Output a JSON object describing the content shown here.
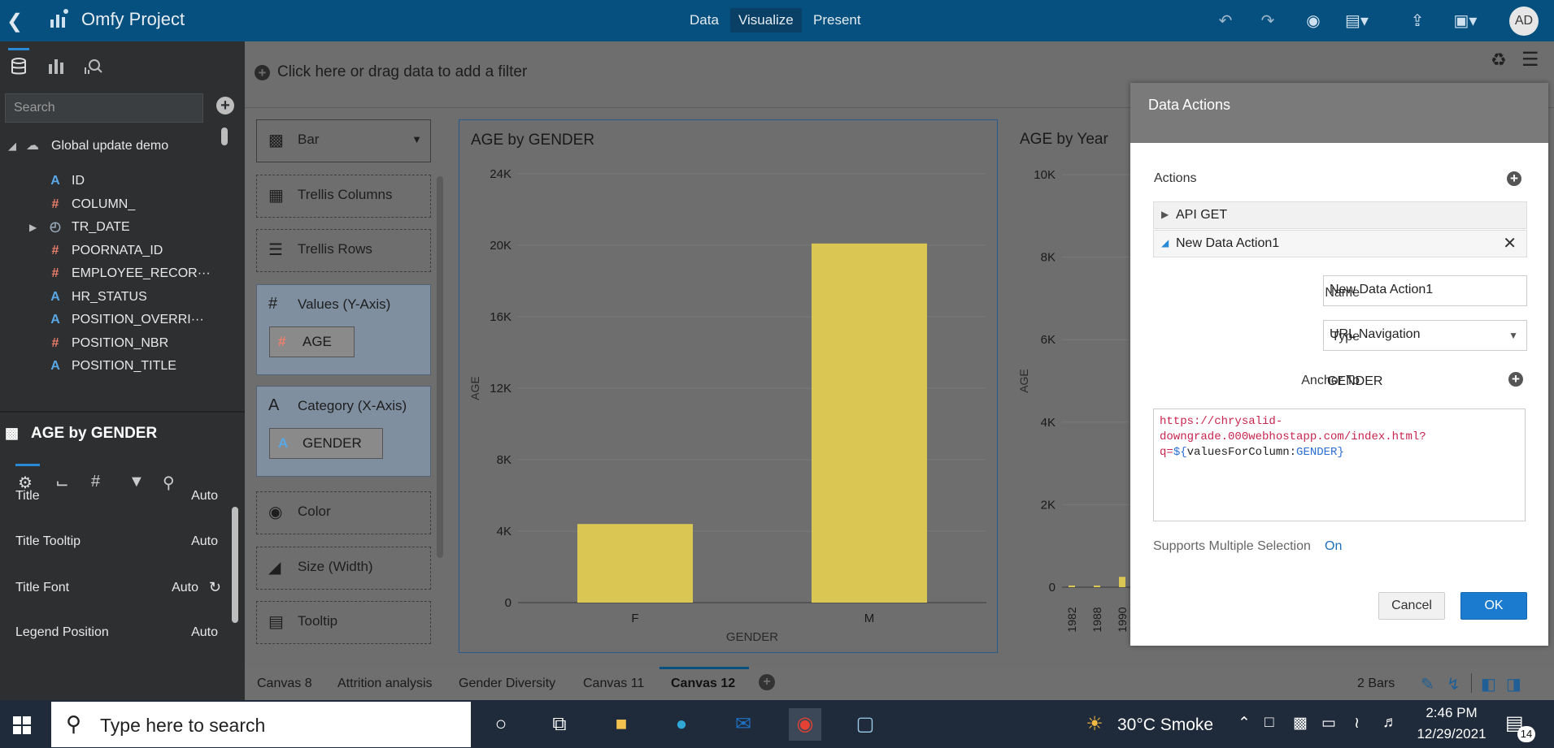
{
  "app": {
    "title": "Omfy Project",
    "modes": [
      "Data",
      "Visualize",
      "Present"
    ],
    "active_mode": "Visualize",
    "avatar": "AD"
  },
  "left_panel": {
    "search_placeholder": "Search",
    "dataset": "Global update demo",
    "columns": [
      {
        "name": "ID",
        "type": "A"
      },
      {
        "name": "COLUMN_",
        "type": "#"
      },
      {
        "name": "TR_DATE",
        "type": "date"
      },
      {
        "name": "POORNATA_ID",
        "type": "#"
      },
      {
        "name": "EMPLOYEE_RECOR···",
        "type": "#"
      },
      {
        "name": "HR_STATUS",
        "type": "A"
      },
      {
        "name": "POSITION_OVERRI···",
        "type": "A"
      },
      {
        "name": "POSITION_NBR",
        "type": "#"
      },
      {
        "name": "POSITION_TITLE",
        "type": "A"
      }
    ],
    "viz_title": "AGE by GENDER",
    "properties": [
      {
        "label": "Title",
        "value": "Auto"
      },
      {
        "label": "Title Tooltip",
        "value": "Auto"
      },
      {
        "label": "Title Font",
        "value": "Auto"
      },
      {
        "label": "Legend Position",
        "value": "Auto"
      }
    ]
  },
  "filter_bar": {
    "text": "Click here or drag data to add a filter"
  },
  "grammar": {
    "chart_type": "Bar",
    "trellis_columns": "Trellis Columns",
    "trellis_rows": "Trellis Rows",
    "values_label": "Values (Y-Axis)",
    "values_chip": "AGE",
    "category_label": "Category (X-Axis)",
    "category_chip": "GENDER",
    "color": "Color",
    "size": "Size (Width)",
    "tooltip": "Tooltip"
  },
  "chart_data": [
    {
      "type": "bar",
      "title": "AGE by GENDER",
      "categories": [
        "F",
        "M"
      ],
      "values": [
        4400,
        20100
      ],
      "xlabel": "GENDER",
      "ylabel": "AGE",
      "ylim": [
        0,
        24000
      ],
      "yticks": [
        "0",
        "4K",
        "8K",
        "12K",
        "16K",
        "20K",
        "24K"
      ],
      "color": "#d9c653"
    },
    {
      "type": "bar",
      "title": "AGE by Year",
      "ylabel": "AGE",
      "ylim": [
        0,
        10000
      ],
      "yticks": [
        "0",
        "2K",
        "4K",
        "6K",
        "8K",
        "10K"
      ],
      "categories": [
        "1982",
        "1988",
        "1990"
      ]
    }
  ],
  "canvas_tabs": [
    "Canvas 8",
    "Attrition analysis",
    "Gender Diversity",
    "Canvas 11",
    "Canvas 12"
  ],
  "active_canvas_tab": "Canvas 12",
  "status": {
    "bars": "2 Bars"
  },
  "dialog": {
    "title": "Data Actions",
    "actions_label": "Actions",
    "actions": [
      "API GET",
      "New Data Action1"
    ],
    "name_label": "Name",
    "name_value": "New Data Action1",
    "type_label": "Type",
    "type_value": "URL Navigation",
    "anchor_label": "Anchor To",
    "anchor_value": "GENDER",
    "url_line1": "https://chrysalid-",
    "url_line2": "downgrade.000webhostapp.com/index.html?",
    "url_prefix": "q=",
    "url_dollar": "${",
    "url_fn": "valuesForColumn:",
    "url_col": "GENDER",
    "url_close": "}",
    "multi_label": "Supports Multiple Selection",
    "multi_value": "On",
    "cancel": "Cancel",
    "ok": "OK"
  },
  "taskbar": {
    "search": "Type here to search",
    "weather": "30°C  Smoke",
    "time": "2:46 PM",
    "date": "12/29/2021",
    "notifications": "14"
  }
}
